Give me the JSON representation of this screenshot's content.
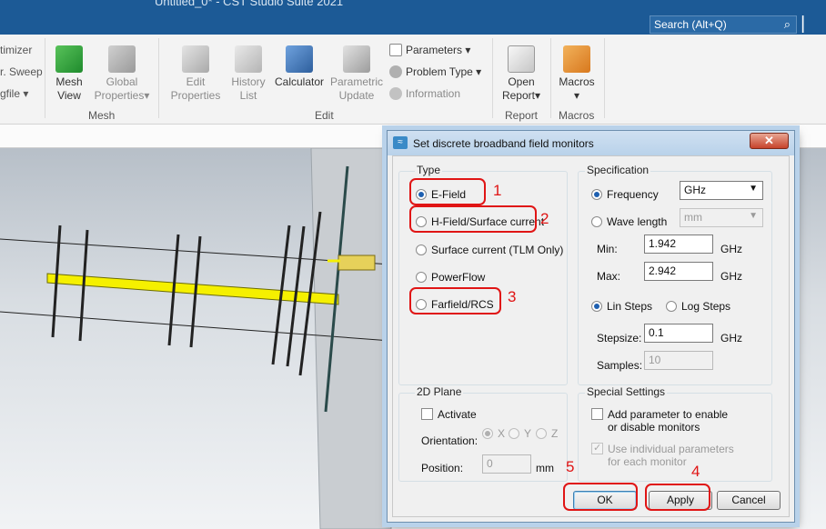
{
  "window": {
    "title_partial": "Untitled_0* - CST Studio Suite 2021"
  },
  "search": {
    "placeholder": "Search (Alt+Q)"
  },
  "ribbon": {
    "left_cut": [
      "timizer",
      "r. Sweep",
      "gfile ▾"
    ],
    "mesh": {
      "view": [
        "Mesh",
        "View"
      ],
      "global": [
        "Global",
        "Properties▾"
      ],
      "group": "Mesh"
    },
    "edit": {
      "edit_props": [
        "Edit",
        "Properties"
      ],
      "history": [
        "History",
        "List"
      ],
      "calculator": "Calculator",
      "param_update": [
        "Parametric",
        "Update"
      ],
      "parameters": "Parameters ▾",
      "problem_type": "Problem Type ▾",
      "information": "Information",
      "group": "Edit"
    },
    "report": {
      "open": [
        "Open",
        "Report▾"
      ],
      "group": "Report"
    },
    "macros": {
      "label": "Macros",
      "arrow": "▾",
      "group": "Macros"
    }
  },
  "dialog": {
    "title": "Set discrete broadband field monitors",
    "close_glyph": "✕",
    "type": {
      "label": "Type",
      "options": [
        "E-Field",
        "H-Field/Surface current",
        "Surface current (TLM Only)",
        "PowerFlow",
        "Farfield/RCS"
      ],
      "selected": "E-Field"
    },
    "specification": {
      "label": "Specification",
      "frequency_label": "Frequency",
      "frequency_unit": "GHz",
      "wavelength_label": "Wave length",
      "wavelength_unit": "mm",
      "min_label": "Min:",
      "min_value": "1.942",
      "max_label": "Max:",
      "max_value": "2.942",
      "ghz": "GHz",
      "lin_steps": "Lin Steps",
      "log_steps": "Log Steps",
      "stepsize_label": "Stepsize:",
      "stepsize_value": "0.1",
      "samples_label": "Samples:",
      "samples_value": "10"
    },
    "plane2d": {
      "label": "2D Plane",
      "activate": "Activate",
      "orientation_label": "Orientation:",
      "axes": [
        "X",
        "Y",
        "Z"
      ],
      "position_label": "Position:",
      "position_value": "0",
      "position_unit": "mm"
    },
    "special": {
      "label": "Special Settings",
      "add_param": [
        "Add parameter to enable",
        "or disable monitors"
      ],
      "use_individual": [
        "Use individual parameters",
        "for each monitor"
      ]
    },
    "buttons": {
      "ok": "OK",
      "apply": "Apply",
      "cancel": "Cancel"
    }
  },
  "annotations": [
    "1",
    "2",
    "3",
    "4",
    "5"
  ],
  "colors": {
    "title_blue": "#1c5a96",
    "annotation_red": "#e01515",
    "antenna_yellow": "#f5f000"
  }
}
